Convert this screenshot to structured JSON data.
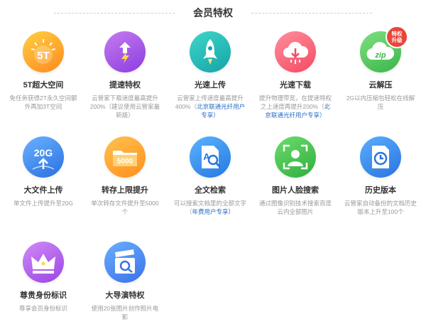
{
  "header": {
    "title": "会员特权"
  },
  "items": [
    {
      "name": "5T超大空间",
      "icon": "5t-storage-icon",
      "icon_text": "5T",
      "color_from": "#ffcf40",
      "color_to": "#ff8a20",
      "desc": "免任务获得2T永久空间额外再加3T空间",
      "desc_hl": ""
    },
    {
      "name": "提速特权",
      "icon": "speed-lightning-icon",
      "icon_text": "",
      "color_from": "#c77bf0",
      "color_to": "#8a3de0",
      "desc": "云管家下载速度最高提升200%（建议使用云管家最新版）",
      "desc_hl": ""
    },
    {
      "name": "光速上传",
      "icon": "rocket-icon",
      "icon_text": "",
      "color_from": "#3fd6c8",
      "color_to": "#16a3a8",
      "desc": "云管家上传速度最高提升400%（",
      "desc_hl": "北京联通光纤用户专享）"
    },
    {
      "name": "光速下载",
      "icon": "cloud-download-icon",
      "icon_text": "",
      "color_from": "#ff8e9c",
      "color_to": "#f24b63",
      "desc": "提升物理带宽，在提速特权之上速度再提升200%（",
      "desc_hl": "北京联通光纤用户专享）"
    },
    {
      "name": "云解压",
      "icon": "zip-cloud-icon",
      "icon_text": "zip",
      "color_from": "#7fe07f",
      "color_to": "#3ab54a",
      "desc": "2G以内压缩包轻松在线解压",
      "desc_hl": "",
      "badge": "特权\n升级"
    },
    {
      "name": "大文件上传",
      "icon": "20g-upload-icon",
      "icon_text": "20G",
      "color_from": "#6ab2ff",
      "color_to": "#2a6fe0",
      "desc": "单文件上传提升至20G",
      "desc_hl": ""
    },
    {
      "name": "转存上限提升",
      "icon": "folder-5000-icon",
      "icon_text": "5000",
      "color_from": "#ffc24d",
      "color_to": "#ff8f1f",
      "desc": "单次转存文件提升至5000个",
      "desc_hl": ""
    },
    {
      "name": "全文检索",
      "icon": "text-search-icon",
      "icon_text": "A",
      "color_from": "#5cb3ff",
      "color_to": "#2479e0",
      "desc": "可以搜索文档里的全部文字（",
      "desc_hl": "年费用户专享）"
    },
    {
      "name": "图片人脸搜索",
      "icon": "face-search-icon",
      "icon_text": "",
      "color_from": "#6cdc6c",
      "color_to": "#2fae3f",
      "desc": "通过图像识别技术搜索百度云内全部图片",
      "desc_hl": ""
    },
    {
      "name": "历史版本",
      "icon": "history-clock-icon",
      "icon_text": "",
      "color_from": "#5aaeff",
      "color_to": "#2a73e0",
      "desc": "云管家自动备份的文档历史版本上升至100个",
      "desc_hl": ""
    },
    {
      "name": "尊贵身份标识",
      "icon": "crown-icon",
      "icon_text": "",
      "color_from": "#d08af5",
      "color_to": "#9a45e6",
      "desc": "尊享会员身份标识",
      "desc_hl": ""
    },
    {
      "name": "大导演特权",
      "icon": "movie-clapper-icon",
      "icon_text": "",
      "color_from": "#6aaeff",
      "color_to": "#3a72e8",
      "desc": "使用20张图片创作照片电影",
      "desc_hl": ""
    }
  ]
}
